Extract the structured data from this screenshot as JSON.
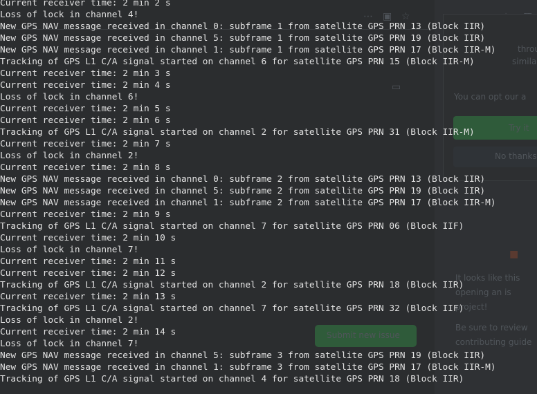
{
  "terminal": {
    "lines": [
      "Current receiver time: 2 min 2 s",
      "Loss of lock in channel 4!",
      "New GPS NAV message received in channel 0: subframe 1 from satellite GPS PRN 13 (Block IIR)",
      "New GPS NAV message received in channel 5: subframe 1 from satellite GPS PRN 19 (Block IIR)",
      "New GPS NAV message received in channel 1: subframe 1 from satellite GPS PRN 17 (Block IIR-M)",
      "Tracking of GPS L1 C/A signal started on channel 6 for satellite GPS PRN 15 (Block IIR-M)",
      "Current receiver time: 2 min 3 s",
      "Current receiver time: 2 min 4 s",
      "Loss of lock in channel 6!",
      "Current receiver time: 2 min 5 s",
      "Current receiver time: 2 min 6 s",
      "Tracking of GPS L1 C/A signal started on channel 2 for satellite GPS PRN 31 (Block IIR-M)",
      "Current receiver time: 2 min 7 s",
      "Loss of lock in channel 2!",
      "Current receiver time: 2 min 8 s",
      "New GPS NAV message received in channel 0: subframe 2 from satellite GPS PRN 13 (Block IIR)",
      "New GPS NAV message received in channel 5: subframe 2 from satellite GPS PRN 19 (Block IIR)",
      "New GPS NAV message received in channel 1: subframe 2 from satellite GPS PRN 17 (Block IIR-M)",
      "Current receiver time: 2 min 9 s",
      "Tracking of GPS L1 C/A signal started on channel 7 for satellite GPS PRN 06 (Block IIF)",
      "Current receiver time: 2 min 10 s",
      "Loss of lock in channel 7!",
      "Current receiver time: 2 min 11 s",
      "Current receiver time: 2 min 12 s",
      "Tracking of GPS L1 C/A signal started on channel 2 for satellite GPS PRN 18 (Block IIR)",
      "Current receiver time: 2 min 13 s",
      "Tracking of GPS L1 C/A signal started on channel 7 for satellite GPS PRN 32 (Block IIF)",
      "Loss of lock in channel 2!",
      "Current receiver time: 2 min 14 s",
      "Loss of lock in channel 7!",
      "New GPS NAV message received in channel 5: subframe 3 from satellite GPS PRN 19 (Block IIR)",
      "New GPS NAV message received in channel 1: subframe 3 from satellite GPS PRN 17 (Block IIR-M)",
      "Tracking of GPS L1 C/A signal started on channel 4 for satellite GPS PRN 18 (Block IIR)"
    ]
  },
  "background_page": {
    "right_panel_snippets": [
      "through",
      "similar",
      "You can opt our a",
      "Try it",
      "No thanks",
      "It looks like this",
      "opening an is",
      "project!",
      "Be sure to review",
      "contributing guide"
    ],
    "submit_button": "Submit new issue"
  },
  "colors": {
    "terminal_text": "#e3e3e3",
    "terminal_bg": "#2b2d2f",
    "bg_button_green": "#2f5b3a"
  }
}
